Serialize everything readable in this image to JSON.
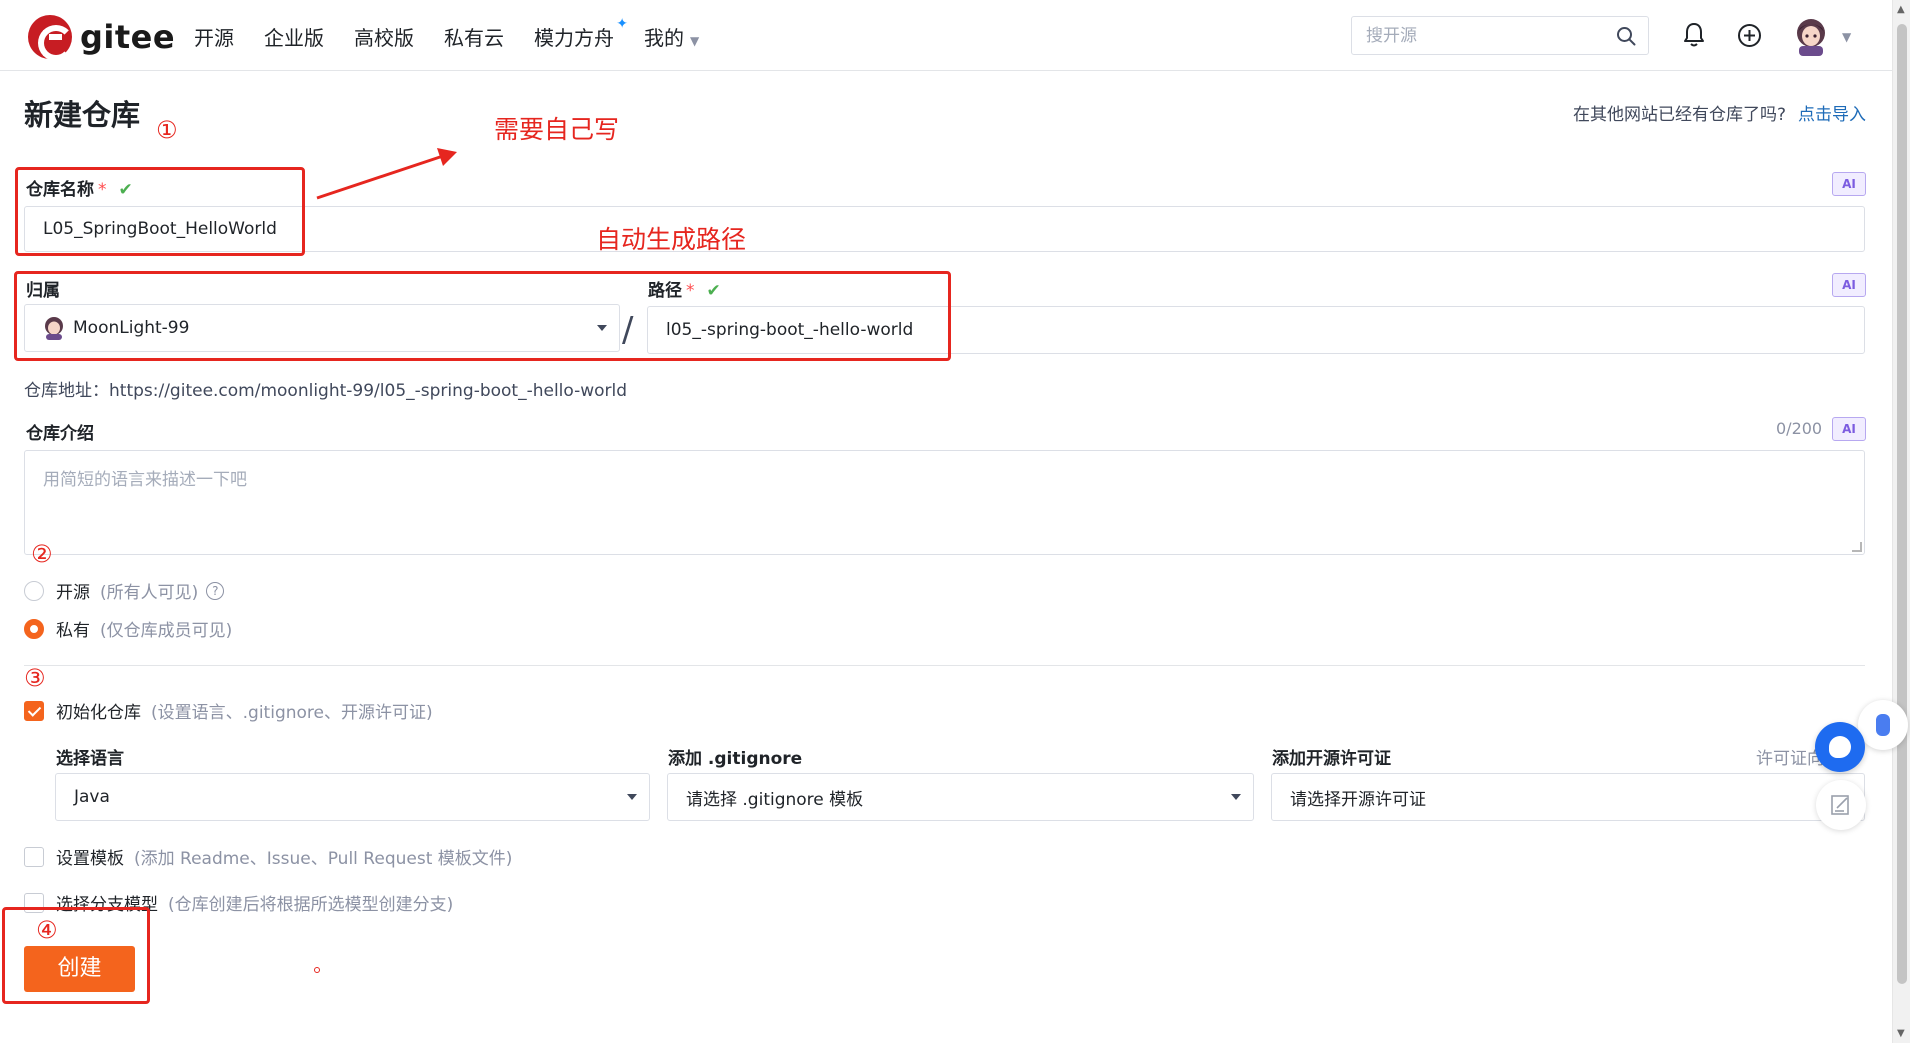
{
  "nav": {
    "brand": "gitee",
    "links": [
      "开源",
      "企业版",
      "高校版",
      "私有云",
      "模力方舟",
      "我的"
    ],
    "search_placeholder": "搜开源"
  },
  "page": {
    "title": "新建仓库",
    "import_hint": "在其他网站已经有仓库了吗?",
    "import_link": "点击导入"
  },
  "form": {
    "repo_name_label": "仓库名称",
    "repo_name_value": "L05_SpringBoot_HelloWorld",
    "owner_label": "归属",
    "owner_value": "MoonLight-99",
    "path_label": "路径",
    "path_value": "l05_-spring-boot_-hello-world",
    "repo_address": "仓库地址：https://gitee.com/moonlight-99/l05_-spring-boot_-hello-world",
    "desc_label": "仓库介绍",
    "desc_counter": "0/200",
    "desc_placeholder": "用简短的语言来描述一下吧",
    "ai_badge": "AI",
    "required_mark": "*",
    "visibility": {
      "public_label": "开源",
      "public_sub": "(所有人可见)",
      "private_label": "私有",
      "private_sub": "(仅仓库成员可见)",
      "selected": "private"
    },
    "init": {
      "label": "初始化仓库",
      "sub": "(设置语言、.gitignore、开源许可证)",
      "checked": true,
      "language_label": "选择语言",
      "language_value": "Java",
      "gitignore_label": "添加 .gitignore",
      "gitignore_value": "请选择 .gitignore 模板",
      "license_label": "添加开源许可证",
      "license_value": "请选择开源许可证",
      "license_help": "许可证向"
    },
    "template": {
      "label": "设置模板",
      "sub": "(添加 Readme、Issue、Pull Request 模板文件)",
      "checked": false
    },
    "branch_model": {
      "label": "选择分支模型",
      "sub": "(仓库创建后将根据所选模型创建分支)",
      "checked": false
    },
    "create_button": "创建"
  },
  "annotations": {
    "num1": "①",
    "num2": "②",
    "num3": "③",
    "num4": "④",
    "write_yourself": "需要自己写",
    "auto_path": "自动生成路径",
    "color": "#e6261f"
  },
  "colors": {
    "accent": "#f4641d",
    "brand": "#c71d23",
    "link": "#1e6bb8",
    "success": "#4caf50"
  }
}
